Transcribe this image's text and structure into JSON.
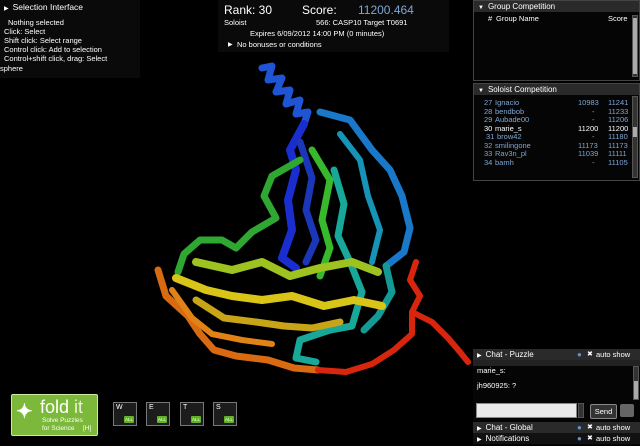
{
  "selection": {
    "title": "Selection Interface",
    "lines": [
      "Nothing selected",
      "Click: Select",
      "Shift click: Select range",
      "Control click: Add to selection",
      "Control+shift click, drag: Select",
      "sphere"
    ]
  },
  "score_panel": {
    "rank_label": "Rank: 30",
    "score_label": "Score:",
    "score_value": "11200.464",
    "mode": "Soloist",
    "puzzle": "566: CASP10 Target T0691",
    "expires": "Expires 6/09/2012 14:00 PM (0 minutes)",
    "bonuses": "No bonuses or conditions"
  },
  "group_competition": {
    "title": "Group Competition",
    "col_num": "#",
    "col_name": "Group Name",
    "col_score": "Score"
  },
  "soloist_competition": {
    "title": "Soloist Competition",
    "rows": [
      {
        "rank": "27",
        "name": "Ignacio",
        "v1": "10983",
        "v2": "11241"
      },
      {
        "rank": "28",
        "name": "bendbob",
        "v1": "-",
        "v2": "11233"
      },
      {
        "rank": "29",
        "name": "Aubade00",
        "v1": "-",
        "v2": "11206"
      },
      {
        "rank": "30",
        "name": "marie_s",
        "v1": "11200",
        "v2": "11200"
      },
      {
        "rank": "31",
        "name": "brow42",
        "v1": "-",
        "v2": "11180"
      },
      {
        "rank": "32",
        "name": "smilingone",
        "v1": "11173",
        "v2": "11173"
      },
      {
        "rank": "33",
        "name": "Rav3n_pl",
        "v1": "11039",
        "v2": "11111"
      },
      {
        "rank": "34",
        "name": "bamh",
        "v1": "-",
        "v2": "11105"
      }
    ]
  },
  "chat_puzzle": {
    "title": "Chat - Puzzle",
    "auto_show": "auto show",
    "messages": [
      "marie_s:",
      "jh960925: ?"
    ],
    "send": "Send"
  },
  "chat_global": {
    "title": "Chat - Global",
    "auto_show": "auto show"
  },
  "notifications": {
    "title": "Notifications",
    "auto_show": "auto show"
  },
  "logo": {
    "name": "fold",
    "name2": "it",
    "tagline1": "Solve Puzzles",
    "tagline2": "for Science",
    "hotkey": "[H]"
  },
  "tools": [
    {
      "letter": "W",
      "all": "ALL"
    },
    {
      "letter": "E",
      "all": "ALL"
    },
    {
      "letter": "T",
      "all": "ALL"
    },
    {
      "letter": "S",
      "all": "ALL"
    }
  ],
  "colors": {
    "score_blue": "#7fa6d6",
    "logo_green": "#7cb93a",
    "chat_blue": "#5b93cf"
  }
}
